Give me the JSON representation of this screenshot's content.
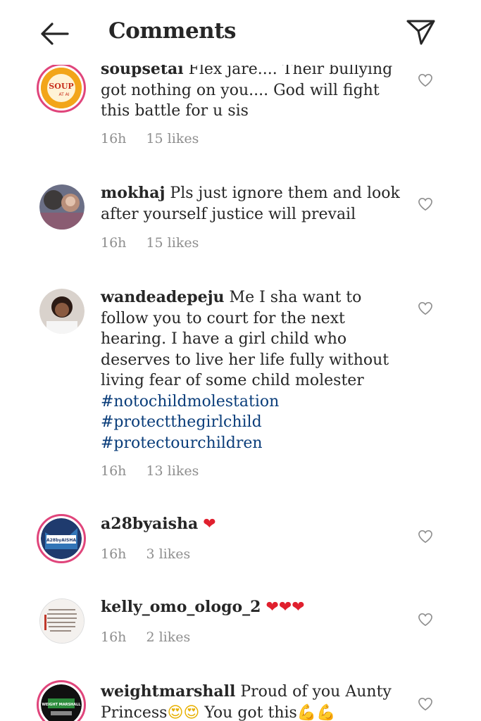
{
  "header": {
    "title": "Comments"
  },
  "comments": [
    {
      "username": "soupsetai",
      "text": "Flex jare.... Their bullying got nothing on you.... God will fight this battle for u sis",
      "time": "16h",
      "likes": "15 likes",
      "avatar_text": "SOUP",
      "avatar_subtext": "AT AI"
    },
    {
      "username": "mokhaj",
      "text": "Pls just ignore them and look after yourself justice will prevail",
      "time": "16h",
      "likes": "15 likes"
    },
    {
      "username": "wandeadepeju",
      "text": "Me I sha want to follow you to court for the next hearing. I have a girl child who deserves to live her life fully without living fear of some child molester",
      "hashtags": [
        "#notochildmolestation",
        "#protectthegirlchild",
        "#protectourchildren"
      ],
      "time": "16h",
      "likes": "13 likes"
    },
    {
      "username": "a28byaisha",
      "text": "",
      "emoji": "❤",
      "time": "16h",
      "likes": "3 likes",
      "avatar_text": "A28byAISHA"
    },
    {
      "username": "kelly_omo_ologo_2",
      "text": "",
      "emoji": "❤❤❤",
      "time": "16h",
      "likes": "2 likes"
    },
    {
      "username": "weightmarshall",
      "text": "Proud of you Aunty Princess",
      "emoji_faces": "😍😍",
      "text2": " You got",
      "text3": " this",
      "emoji_arms": "💪💪",
      "avatar_text": "WEIGHT MARSHALL"
    }
  ],
  "icons": {
    "back": "arrow-left-icon",
    "send": "paper-plane-icon",
    "like": "heart-outline-icon"
  },
  "colors": {
    "text": "#262626",
    "meta": "#8e8e8e",
    "hashtag": "#0a3d7a",
    "story_ring": "#e0457b"
  }
}
